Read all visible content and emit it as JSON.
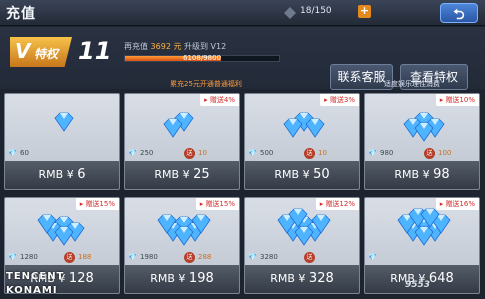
{
  "header": {
    "title": "充值",
    "resource_count": "18/150",
    "resource_plus": "+",
    "back_icon": "back-arrow-icon"
  },
  "vip": {
    "badge_v": "V",
    "badge_text": "特权",
    "level": "11",
    "progress_label": "再充值",
    "progress_amount": "3692 元",
    "progress_next": "升级到 V12",
    "progress_text": "6108/9800",
    "progress_fraction": 0.623
  },
  "buttons": {
    "service": "联系客服",
    "privilege": "查看特权"
  },
  "notice": "累充25元开通普通福利",
  "consumption_tip": "适度娱乐理性消费",
  "cards": [
    {
      "bonus": "",
      "gems": "60",
      "gift": "",
      "gift_count": "",
      "price": "6"
    },
    {
      "bonus": "赠送4%",
      "gems": "250",
      "gift": "送",
      "gift_count": "10",
      "price": "25"
    },
    {
      "bonus": "赠送3%",
      "gems": "500",
      "gift": "送",
      "gift_count": "10",
      "price": "50"
    },
    {
      "bonus": "赠送10%",
      "gems": "980",
      "gift": "送",
      "gift_count": "100",
      "price": "98"
    },
    {
      "bonus": "赠送15%",
      "gems": "1280",
      "gift": "送",
      "gift_count": "188",
      "price": "128"
    },
    {
      "bonus": "赠送15%",
      "gems": "1980",
      "gift": "送",
      "gift_count": "288",
      "price": "198"
    },
    {
      "bonus": "赠送12%",
      "gems": "3280",
      "gift": "送",
      "gift_count": "",
      "price": "328"
    },
    {
      "bonus": "赠送16%",
      "gems": "",
      "gift": "",
      "gift_count": "",
      "price": "648"
    }
  ],
  "price_prefix": "RMB ¥ ",
  "watermark": {
    "line1": "TENCENT",
    "line2": "KONAMI",
    "site": "9553"
  },
  "colors": {
    "accent_orange": "#e38a1e",
    "bonus_red": "#d02a2a",
    "gem_blue": "#4fb4ff"
  }
}
